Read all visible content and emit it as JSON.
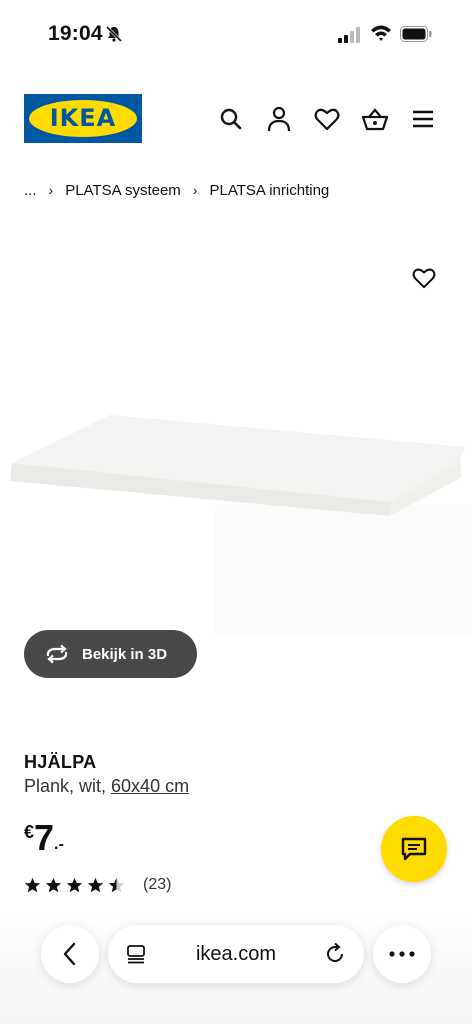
{
  "status_bar": {
    "time": "19:04"
  },
  "header": {
    "logo_text": "IKEA",
    "icons": [
      "search-icon",
      "account-icon",
      "heart-icon",
      "basket-icon",
      "menu-icon"
    ]
  },
  "breadcrumb": {
    "ellipsis": "...",
    "items": [
      "PLATSA systeem",
      "PLATSA inrichting"
    ]
  },
  "product": {
    "name": "HJÄLPA",
    "description_prefix": "Plank, wit, ",
    "size_link": "60x40 cm",
    "price_currency": "€",
    "price_integer": "7",
    "price_decimals": ".-",
    "rating_value": 4.5,
    "rating_max": 5,
    "rating_count": "(23)",
    "view3d_label": "Bekijk in 3D"
  },
  "browser": {
    "url": "ikea.com"
  },
  "colors": {
    "ikea_blue": "#0058a3",
    "ikea_yellow": "#ffdb00",
    "button_dark": "#484848"
  }
}
